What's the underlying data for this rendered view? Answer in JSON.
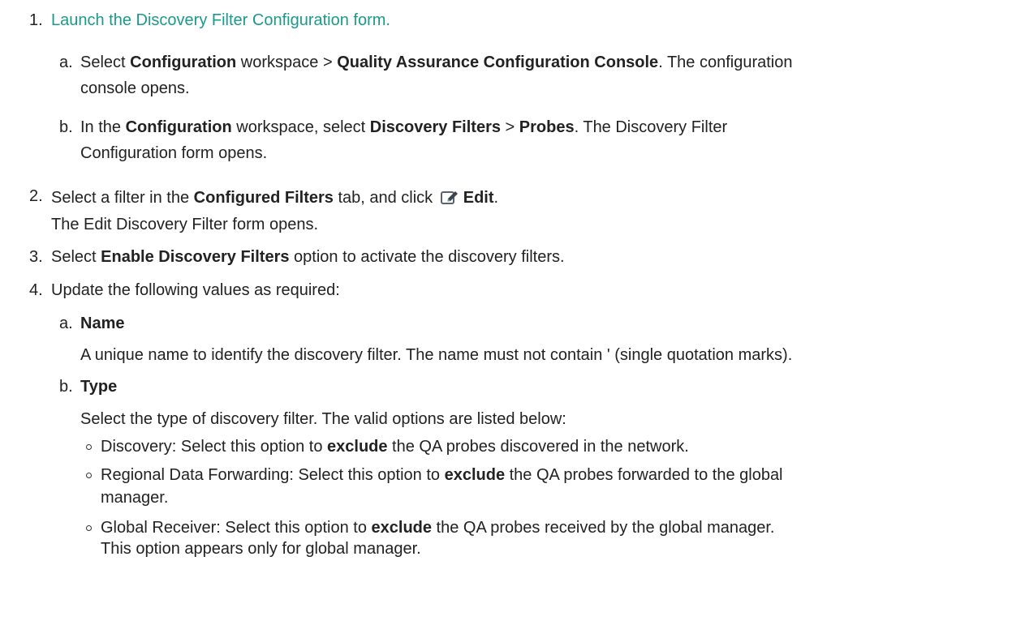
{
  "steps": [
    {
      "number": "1.",
      "link_text": "Launch the Discovery Filter Configuration form.",
      "substeps": [
        {
          "letter": "a.",
          "t1": "Select ",
          "b1": "Configuration",
          "t2": " workspace > ",
          "b2": "Quality Assurance Configuration Console",
          "t3": ". The configuration",
          "line2": "console opens."
        },
        {
          "letter": "b.",
          "t1": "In the ",
          "b1": "Configuration",
          "t2": " workspace, select ",
          "b2": "Discovery Filters",
          "t3": " > ",
          "b3": "Probes",
          "t4": ". The Discovery Filter",
          "line2": "Configuration form opens."
        }
      ]
    },
    {
      "number": "2.",
      "t1": "Select a filter in the ",
      "b1": "Configured Filters",
      "t2": " tab, and click ",
      "icon": "edit-icon",
      "b2": "Edit",
      "t3": ".",
      "line2": "The Edit Discovery Filter form opens."
    },
    {
      "number": "3.",
      "t1": "Select ",
      "b1": "Enable Discovery Filters",
      "t2": " option to activate the discovery filters."
    },
    {
      "number": "4.",
      "t1": "Update the following values as required:",
      "substeps": [
        {
          "letter": "a.",
          "title": "Name",
          "desc": "A unique name to identify the discovery filter. The name must not contain ' (single quotation marks)."
        },
        {
          "letter": "b.",
          "title": "Type",
          "desc": "Select the type of discovery filter. The valid options are listed below:",
          "options": [
            {
              "t1": "Discovery: Select this option to ",
              "b1": "exclude",
              "t2": " the QA probes discovered in the network."
            },
            {
              "t1": "Regional Data Forwarding: Select this option to ",
              "b1": "exclude",
              "t2": " the QA probes forwarded to the global",
              "line2": "manager."
            },
            {
              "t1": "Global Receiver: Select this option to ",
              "b1": "exclude",
              "t2": " the QA probes received by the global manager.",
              "line2": "This option appears only for global manager."
            }
          ]
        }
      ]
    }
  ]
}
